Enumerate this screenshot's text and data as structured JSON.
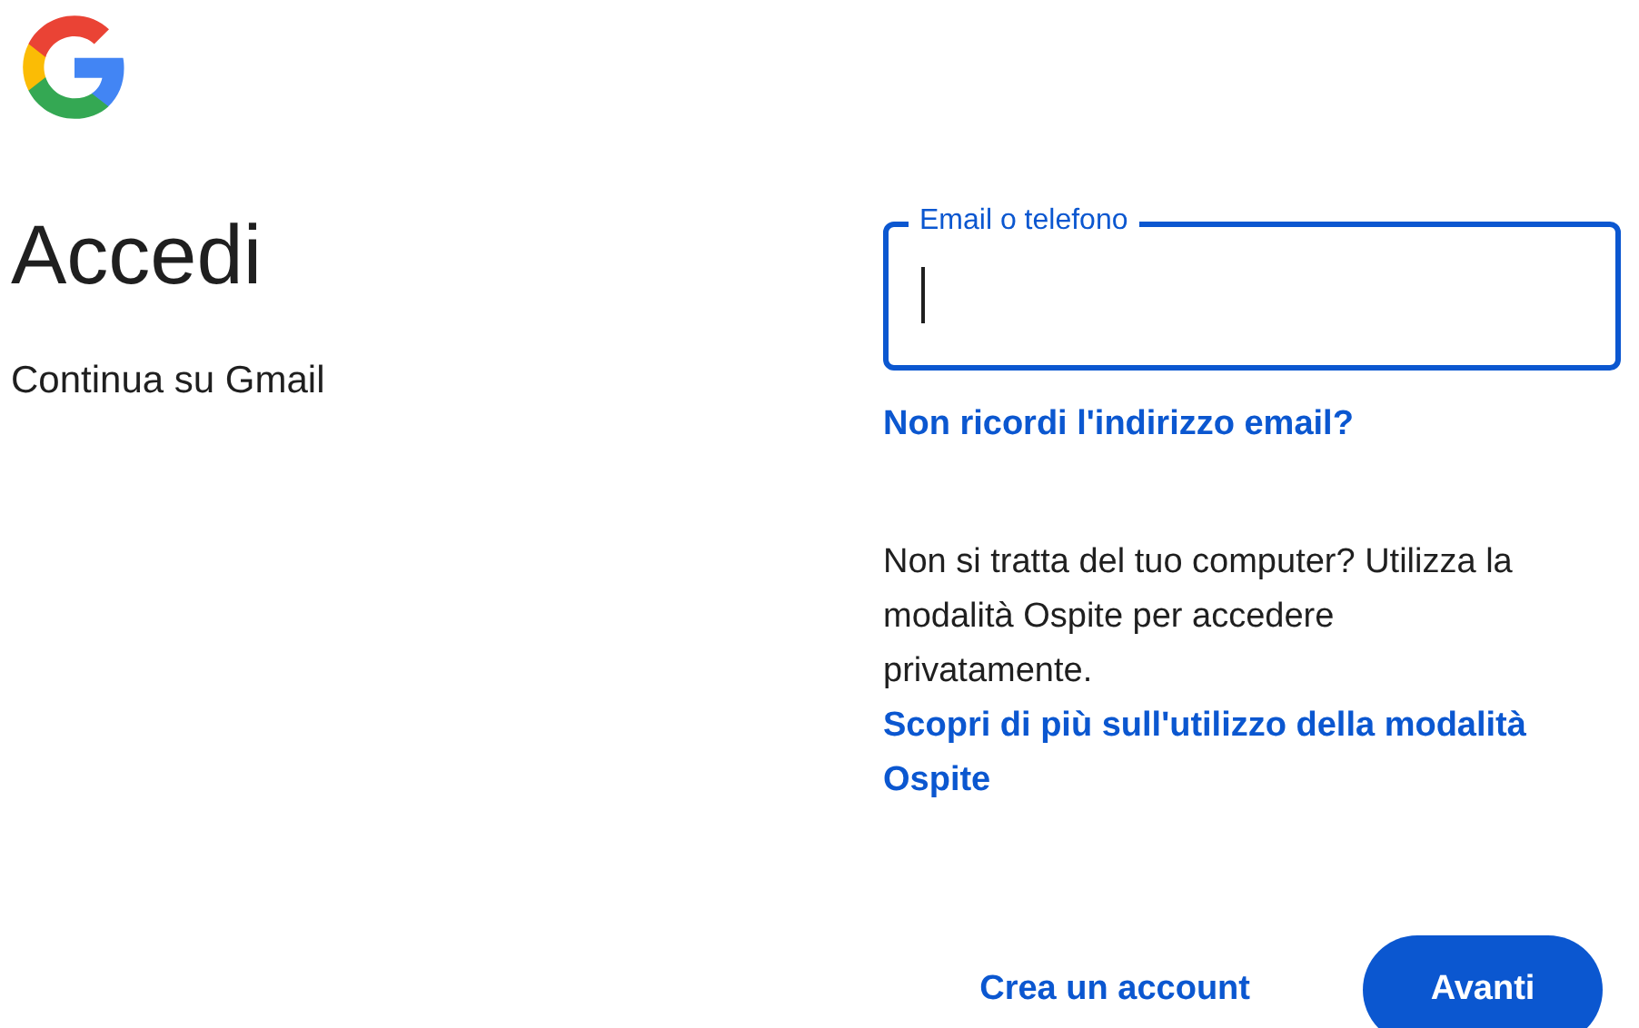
{
  "heading": {
    "title": "Accedi",
    "subtitle": "Continua su Gmail"
  },
  "email_field": {
    "label": "Email o telefono",
    "focused": true
  },
  "forgot_link": "Non ricordi l'indirizzo email?",
  "guest_note": {
    "text": "Non si tratta del tuo computer? Utilizza la modalità Ospite per accedere privatamente.",
    "link": "Scopri di più sull'utilizzo della modalità Ospite"
  },
  "buttons": [
    {
      "label": "Crea un account",
      "kind": "text"
    },
    {
      "label": "Avanti",
      "kind": "filled"
    }
  ]
}
